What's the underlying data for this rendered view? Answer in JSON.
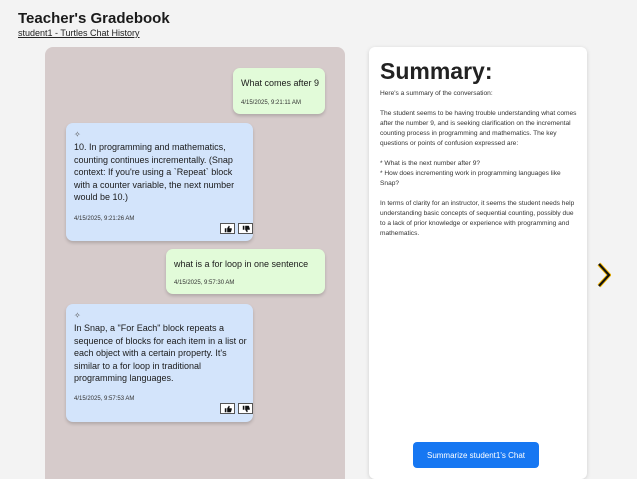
{
  "header": {
    "title": "Teacher's Gradebook",
    "subtitle": "student1 - Turtles Chat History"
  },
  "chat": {
    "messages": [
      {
        "role": "user",
        "text": "What comes after 9",
        "time": "4/15/2025, 9:21:11 AM"
      },
      {
        "role": "bot",
        "icon": "sparkle-icon",
        "text": "10. In programming and mathematics, counting continues incrementally. (Snap context: If you're using a `Repeat` block with a counter variable, the next number would be 10.)",
        "time": "4/15/2025, 9:21:26 AM"
      },
      {
        "role": "user",
        "text": "what is a for loop in one sentence",
        "time": "4/15/2025, 9:57:30 AM"
      },
      {
        "role": "bot",
        "icon": "sparkle-icon",
        "text": "In Snap, a \"For Each\" block repeats a sequence of blocks for each item in a list or each object with a certain property. It's similar to a for loop in traditional programming languages.",
        "time": "4/15/2025, 9:57:53 AM"
      }
    ]
  },
  "summary": {
    "title": "Summary:",
    "paragraphs": [
      "Here's a summary of the conversation:",
      "The student seems to be having trouble understanding what comes after the number 9, and is seeking clarification on the incremental counting process in programming and mathematics. The key questions or points of confusion expressed are:",
      "* What is the next number after 9?\n* How does incrementing work in programming languages like Snap?",
      "In terms of clarity for an instructor, it seems the student needs help understanding basic concepts of sequential counting, possibly due to a lack of prior knowledge or experience with programming and mathematics."
    ],
    "button_label": "Summarize student1's Chat"
  },
  "colors": {
    "user_bubble": "#e2fbd9",
    "bot_bubble": "#d3e4fb",
    "chat_panel": "#d6cbcb",
    "button": "#1677f2",
    "arrow": "#f5b800"
  }
}
